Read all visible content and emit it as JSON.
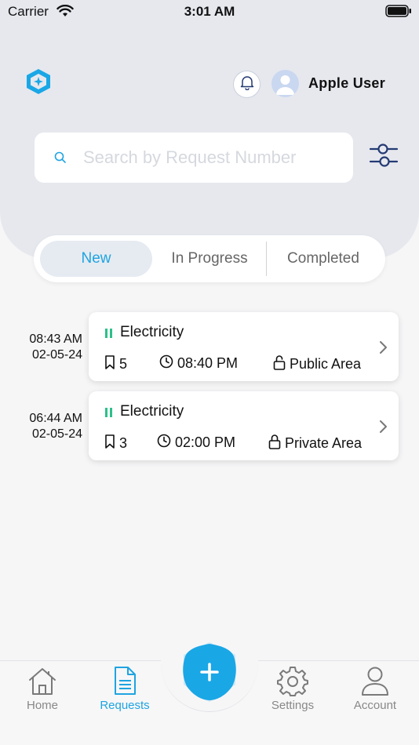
{
  "status_bar": {
    "carrier": "Carrier",
    "time": "3:01 AM"
  },
  "header": {
    "user_name": "Apple User"
  },
  "search": {
    "placeholder": "Search by Request Number",
    "value": ""
  },
  "tabs": [
    {
      "label": "New",
      "active": true
    },
    {
      "label": "In Progress",
      "active": false
    },
    {
      "label": "Completed",
      "active": false
    }
  ],
  "requests": [
    {
      "time": "08:43 AM",
      "date": "02-05-24",
      "title": "Electricity",
      "count": "5",
      "scheduled": "08:40 PM",
      "area": "Public Area",
      "area_icon": "unlock-icon"
    },
    {
      "time": "06:44 AM",
      "date": "02-05-24",
      "title": "Electricity",
      "count": "3",
      "scheduled": "02:00 PM",
      "area": "Private Area",
      "area_icon": "lock-icon"
    }
  ],
  "nav": [
    {
      "label": "Home",
      "icon": "home-icon",
      "active": false
    },
    {
      "label": "Requests",
      "icon": "document-icon",
      "active": true
    },
    {
      "label": "Settings",
      "icon": "gear-icon",
      "active": false
    },
    {
      "label": "Account",
      "icon": "user-icon",
      "active": false
    }
  ],
  "colors": {
    "accent": "#1fa4e0",
    "status_green": "#2cc08a",
    "header_bg": "#e6e8ee",
    "navy": "#243a73"
  }
}
